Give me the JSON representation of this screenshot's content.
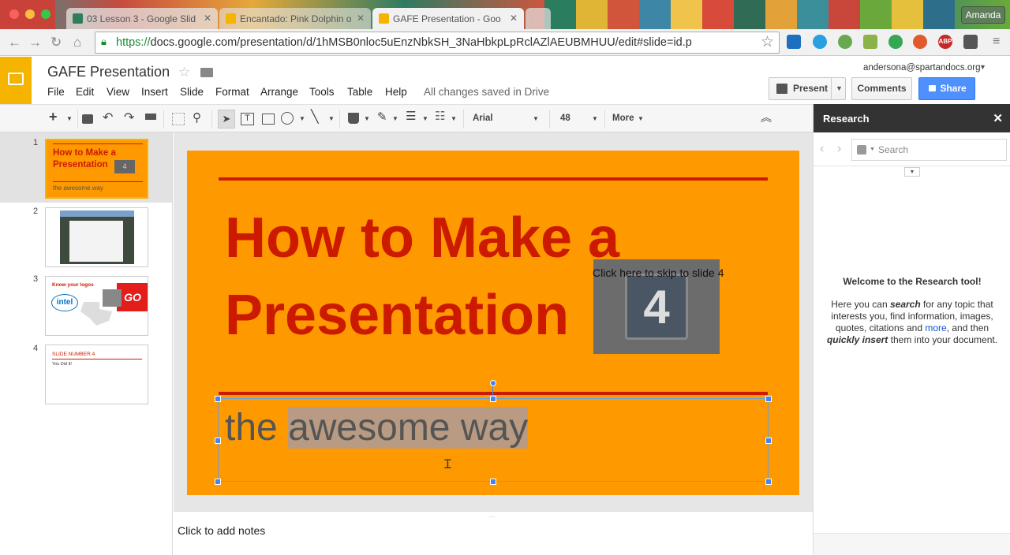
{
  "browser": {
    "tabs": [
      {
        "title": "03 Lesson 3 - Google Slid"
      },
      {
        "title": "Encantado: Pink Dolphin o"
      },
      {
        "title": "GAFE Presentation - Goo"
      }
    ],
    "user": "Amanda",
    "url_scheme": "https://",
    "url_rest": "docs.google.com/presentation/d/1hMSB0nloc5uEnzNbkSH_3NaHbkpLpRclAZlAEUBMHUU/edit#slide=id.p",
    "ext_abp": "ABP"
  },
  "app": {
    "title": "GAFE Presentation",
    "account": "andersona@spartandocs.org",
    "menus": [
      "File",
      "Edit",
      "View",
      "Insert",
      "Slide",
      "Format",
      "Arrange",
      "Tools",
      "Table",
      "Help"
    ],
    "saved_status": "All changes saved in Drive",
    "present_label": "Present",
    "comments_label": "Comments",
    "share_label": "Share"
  },
  "toolbar": {
    "font": "Arial",
    "size": "48",
    "more": "More"
  },
  "filmstrip": {
    "nums": [
      "1",
      "2",
      "3",
      "4"
    ],
    "t1_title": "How to Make a Presentation",
    "t1_sub": "the awesome way",
    "t1_badge": "4",
    "t3_title": "Know your logos",
    "t3_intel": "intel",
    "t3_go": "GO",
    "t4_title": "SLIDE NUMBER 4",
    "t4_body": "You Did it!"
  },
  "slide": {
    "title_line1": "How to Make a",
    "title_line2": "Presentation",
    "subtitle_plain": "the ",
    "subtitle_selected": "awesome way",
    "link_text": "Click here to skip to slide 4",
    "image_number": "4"
  },
  "notes_placeholder": "Click to add notes",
  "research": {
    "title": "Research",
    "search_placeholder": "Search",
    "welcome": "Welcome to the Research tool!",
    "p1": "Here you can ",
    "p_search": "search",
    "p2": " for any topic that interests you, find information, images, quotes, citations and ",
    "p_more": "more",
    "p3": ", and then ",
    "p_insert": "quickly insert",
    "p4": " them into your document."
  },
  "colors": {
    "slide_bg": "#ff9900",
    "title_red": "#cc1a00",
    "accent_blue": "#4285f4"
  }
}
